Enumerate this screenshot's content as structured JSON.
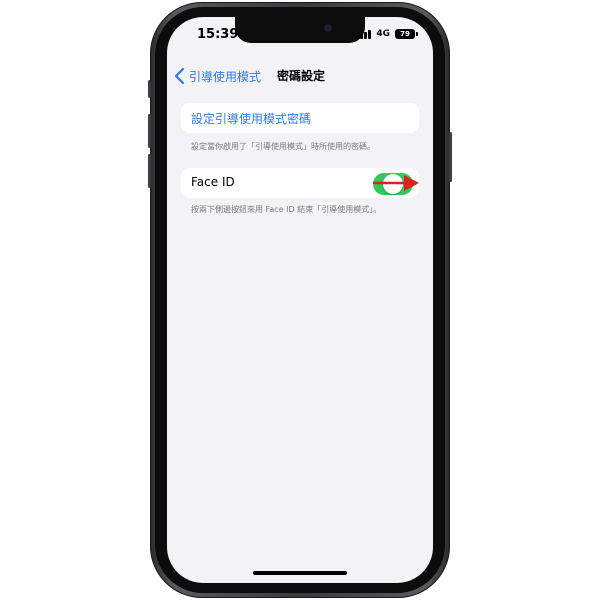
{
  "status_bar": {
    "time": "15:39",
    "network": "4G",
    "battery": "79"
  },
  "nav": {
    "back_label": "引導使用模式",
    "title": "密碼設定"
  },
  "passcode_row": {
    "label": "設定引導使用模式密碼",
    "footnote": "設定當你啟用了「引導使用模式」時所使用的密碼。"
  },
  "faceid_row": {
    "label": "Face ID",
    "toggle_on": true,
    "footnote": "按兩下側邊按鈕來用 Face ID 結束「引導使用模式」。"
  },
  "colors": {
    "accent": "#2f7ae5",
    "toggle_on": "#34c759",
    "annotation_arrow": "#e0201b",
    "background": "#f2f2f7"
  },
  "icons": [
    "back-chevron-icon",
    "signal-icon",
    "battery-icon",
    "arrow-annotation-icon"
  ]
}
